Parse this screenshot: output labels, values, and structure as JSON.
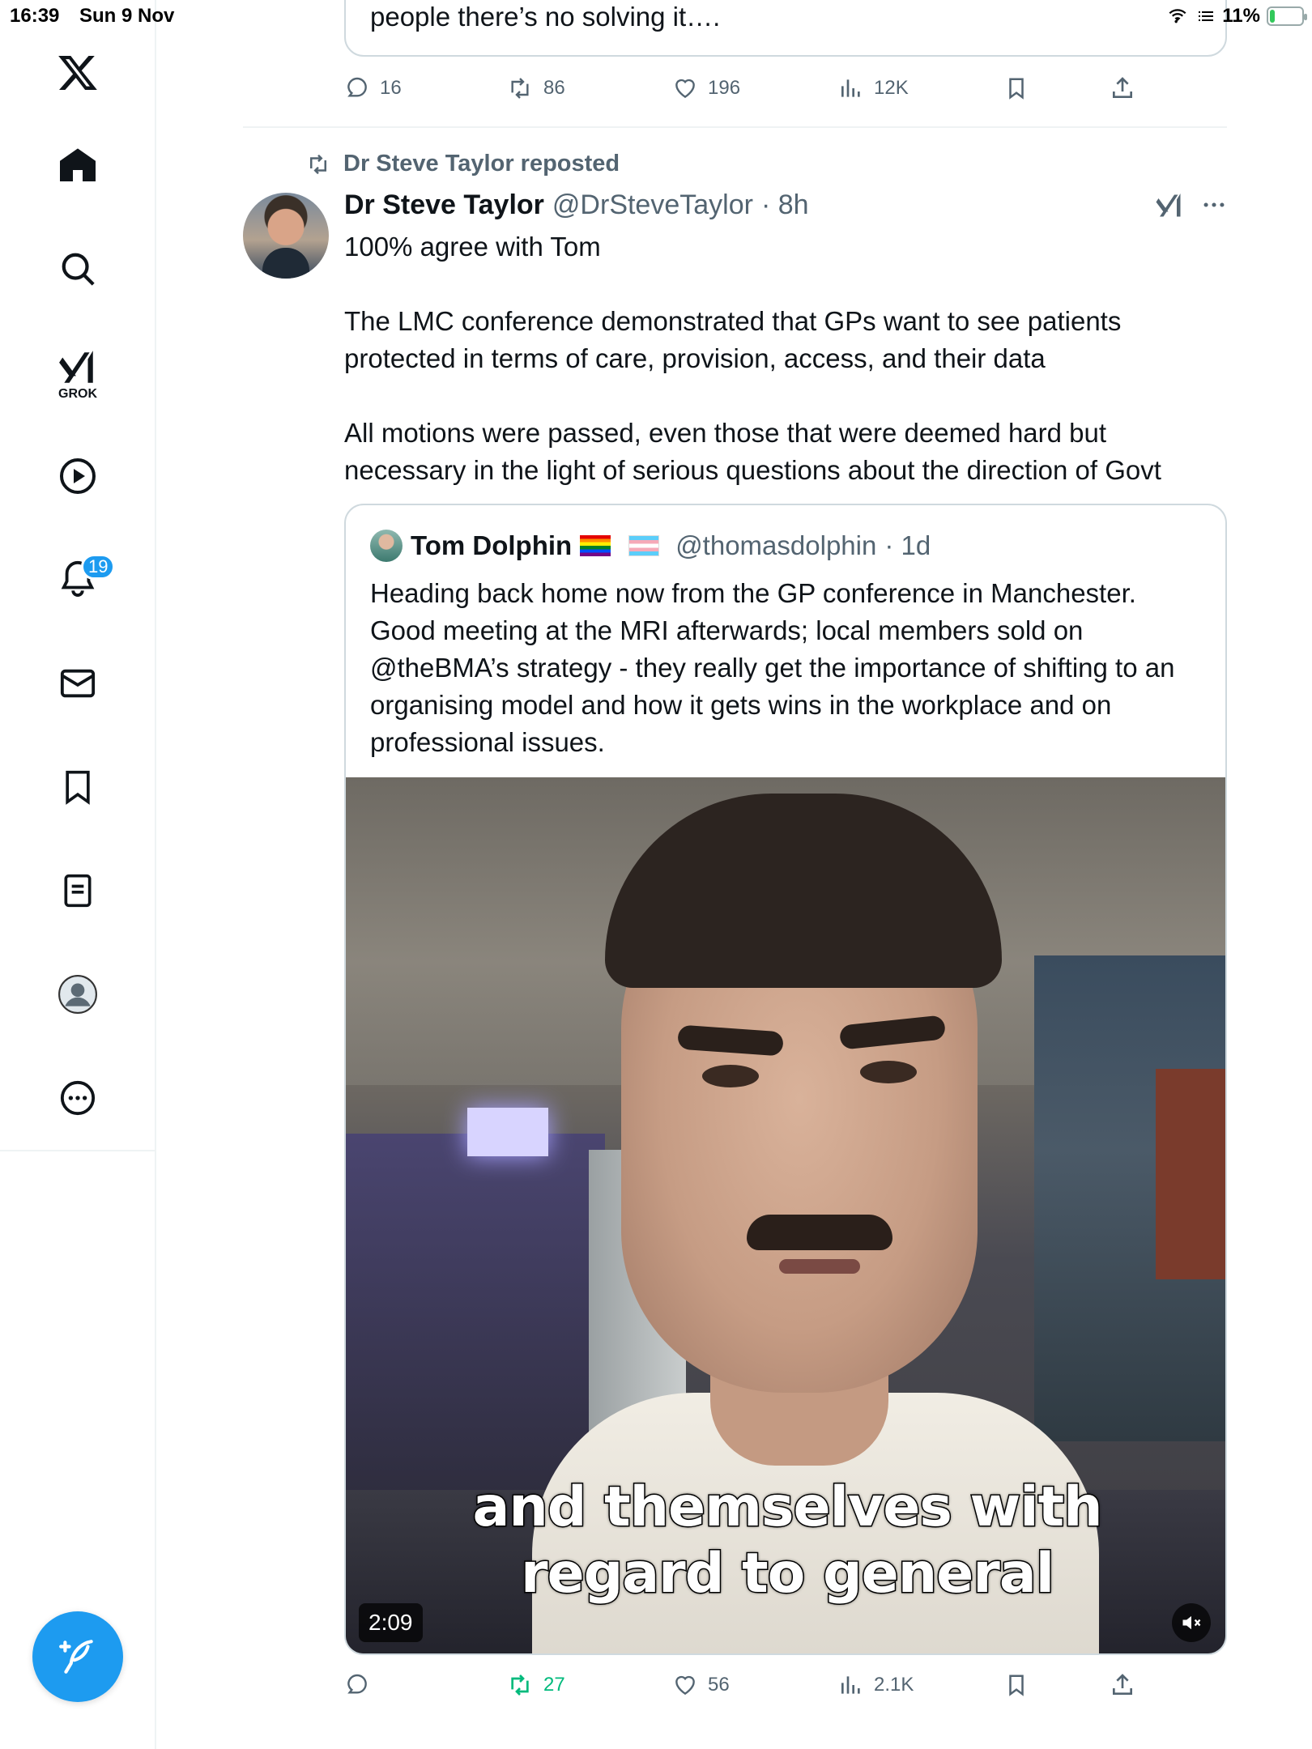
{
  "status_bar": {
    "time": "16:39",
    "date": "Sun 9 Nov",
    "battery": "11%",
    "battery_level": 0.11
  },
  "sidebar": {
    "grok_label": "GROK",
    "notifications_badge": "19"
  },
  "previous_tweet": {
    "text_tail": "people there’s no solving it….",
    "replies": "16",
    "reposts": "86",
    "likes": "196",
    "views": "12K"
  },
  "tweet": {
    "repost_label": "Dr Steve Taylor reposted",
    "author_name": "Dr Steve Taylor",
    "author_handle": "@DrSteveTaylor",
    "time_ago": "· 8h",
    "paragraphs": [
      "100% agree with Tom",
      "The LMC conference demonstrated that GPs want to see patients protected in terms of care, provision, access, and their data",
      "All motions were passed, even those that were deemed hard but necessary in the light of serious questions about the direction of Govt"
    ],
    "quote": {
      "name": "Tom Dolphin",
      "handle": "@thomasdolphin",
      "time_ago": "· 1d",
      "text": "Heading back home now from the GP conference in Manchester. Good meeting at the MRI afterwards; local members sold on @theBMA’s strategy - they really get the importance of shifting to an organising model and how it gets wins in the workplace and on professional issues.",
      "video": {
        "caption_line1": "and themselves with",
        "caption_line2": "regard to general",
        "duration": "2:09"
      }
    },
    "actions": {
      "replies": "",
      "reposts": "27",
      "likes": "56",
      "views": "2.1K"
    }
  },
  "colors": {
    "accent": "#1d9bf0",
    "repost_green": "#00ba7c",
    "muted": "#536471"
  }
}
